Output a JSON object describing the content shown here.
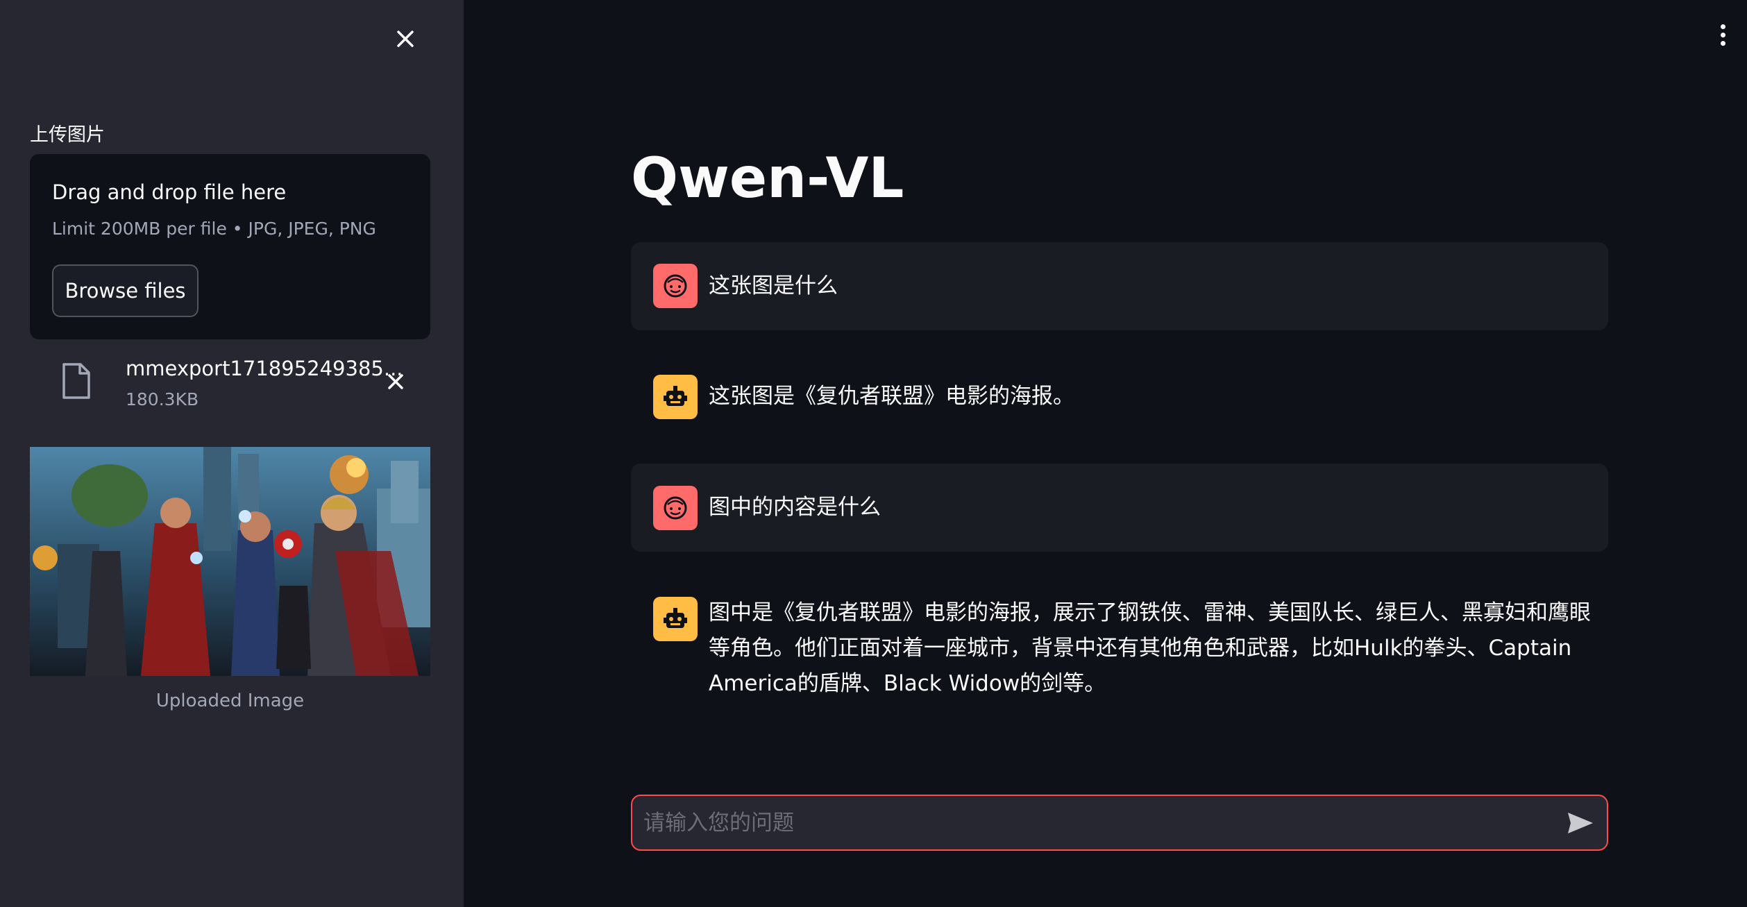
{
  "sidebar": {
    "close_icon": "close-icon",
    "uploader_label": "上传图片",
    "dropzone": {
      "title": "Drag and drop file here",
      "limit": "Limit 200MB per file • JPG, JPEG, PNG",
      "browse_label": "Browse files"
    },
    "file": {
      "name": "mmexport171895249385...",
      "size": "180.3KB",
      "icon": "file-icon",
      "remove_icon": "close-icon"
    },
    "preview_caption": "Uploaded Image"
  },
  "main": {
    "title": "Qwen-VL",
    "messages": [
      {
        "role": "user",
        "text": "这张图是什么"
      },
      {
        "role": "assistant",
        "text": "这张图是《复仇者联盟》电影的海报。"
      },
      {
        "role": "user",
        "text": "图中的内容是什么"
      },
      {
        "role": "assistant",
        "text": "图中是《复仇者联盟》电影的海报，展示了钢铁侠、雷神、美国队长、绿巨人、黑寡妇和鹰眼等角色。他们正面对着一座城市，背景中还有其他角色和武器，比如Hulk的拳头、Captain America的盾牌、Black Widow的剑等。"
      }
    ],
    "chat_input": {
      "placeholder": "请输入您的问题",
      "value": ""
    }
  },
  "colors": {
    "background": "#0e1117",
    "sidebar": "#262730",
    "user_avatar": "#ff6b6b",
    "assistant_avatar": "#ffbd45",
    "accent_border": "#ff4b4b"
  }
}
